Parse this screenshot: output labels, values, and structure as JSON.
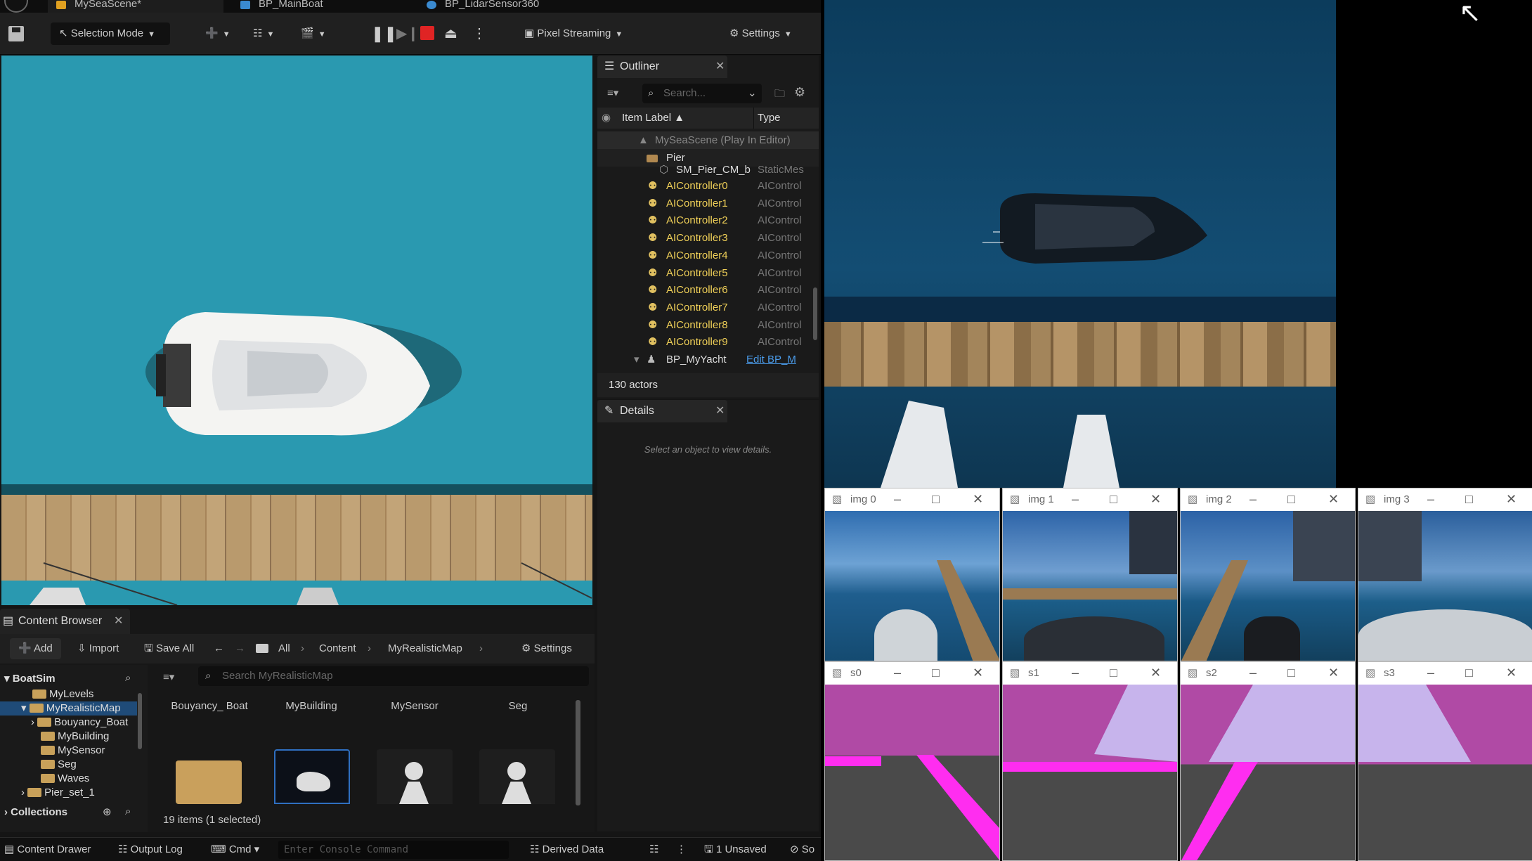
{
  "tabs": [
    {
      "label": "MySeaScene*",
      "color": "#e0a020"
    },
    {
      "label": "BP_MainBoat",
      "color": "#3a8ad0"
    },
    {
      "label": "BP_LidarSensor360",
      "color": "#3a8ad0"
    }
  ],
  "toolbar": {
    "selection_mode": "Selection Mode",
    "pixel_streaming": "Pixel Streaming",
    "settings": "Settings"
  },
  "outliner": {
    "title": "Outliner",
    "search_placeholder": "Search...",
    "col_label": "Item Label",
    "col_type": "Type",
    "root": "MySeaScene (Play In Editor)",
    "folder": "Pier",
    "static_mesh": {
      "label": "SM_Pier_CM_b",
      "type": "StaticMes"
    },
    "controllers": [
      {
        "label": "AIController0",
        "type": "AIControl"
      },
      {
        "label": "AIController1",
        "type": "AIControl"
      },
      {
        "label": "AIController2",
        "type": "AIControl"
      },
      {
        "label": "AIController3",
        "type": "AIControl"
      },
      {
        "label": "AIController4",
        "type": "AIControl"
      },
      {
        "label": "AIController5",
        "type": "AIControl"
      },
      {
        "label": "AIController6",
        "type": "AIControl"
      },
      {
        "label": "AIController7",
        "type": "AIControl"
      },
      {
        "label": "AIController8",
        "type": "AIControl"
      },
      {
        "label": "AIController9",
        "type": "AIControl"
      }
    ],
    "yacht": {
      "label": "BP_MyYacht",
      "type": "Edit BP_M"
    },
    "actor_count": "130 actors"
  },
  "details": {
    "title": "Details",
    "empty": "Select an object to view details."
  },
  "content_browser": {
    "title": "Content Browser",
    "add": "Add",
    "import": "Import",
    "save_all": "Save All",
    "path": [
      "All",
      "Content",
      "MyRealisticMap"
    ],
    "settings": "Settings",
    "tree_root": "BoatSim",
    "tree": [
      "MyLevels",
      "MyRealisticMap",
      "Bouyancy_Boat",
      "MyBuilding",
      "MySensor",
      "Seg",
      "Waves",
      "Pier_set_1"
    ],
    "collections": "Collections",
    "search_placeholder": "Search MyRealisticMap",
    "assets": [
      "Bouyancy_ Boat",
      "MyBuilding",
      "MySensor",
      "Seg"
    ],
    "item_count": "19 items (1 selected)"
  },
  "statusbar": {
    "content_drawer": "Content Drawer",
    "output_log": "Output Log",
    "cmd": "Cmd",
    "console_placeholder": "Enter Console Command",
    "derived_data": "Derived Data",
    "unsaved": "1 Unsaved",
    "source": "So"
  },
  "windows": [
    "img 0",
    "img 1",
    "img 2",
    "img 3",
    "s0",
    "s1",
    "s2",
    "s3"
  ]
}
